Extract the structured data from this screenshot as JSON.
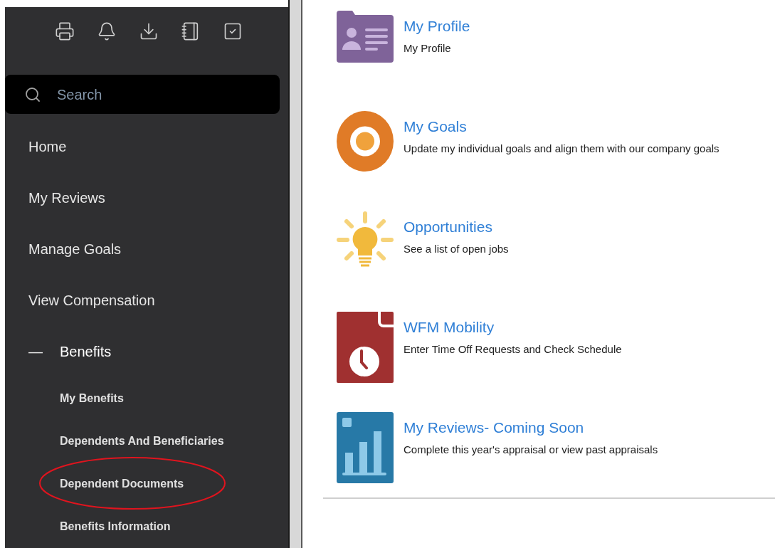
{
  "sidebar": {
    "toolbar": [
      {
        "kind": "print"
      },
      {
        "kind": "bell"
      },
      {
        "kind": "download"
      },
      {
        "kind": "notebook"
      },
      {
        "kind": "checklist"
      }
    ],
    "search": {
      "placeholder": "Search"
    },
    "items": [
      {
        "label": "Home",
        "expanded": false
      },
      {
        "label": "My Reviews",
        "expanded": false
      },
      {
        "label": "Manage Goals",
        "expanded": false
      },
      {
        "label": "View Compensation",
        "expanded": false
      },
      {
        "label": "Benefits",
        "expanded": true,
        "toggle": "—",
        "children": [
          {
            "label": "My Benefits",
            "circled": false
          },
          {
            "label": "Dependents And Beneficiaries",
            "circled": false
          },
          {
            "label": "Dependent Documents",
            "circled": true
          },
          {
            "label": "Benefits Information",
            "circled": false
          }
        ]
      }
    ]
  },
  "apps": [
    {
      "kind": "profile",
      "title": "My Profile",
      "description": "My Profile"
    },
    {
      "kind": "goals",
      "title": "My Goals",
      "description": "Update my individual goals and align them with our company goals"
    },
    {
      "kind": "idea",
      "title": "Opportunities",
      "description": "See a list of open jobs"
    },
    {
      "kind": "clock",
      "title": "WFM Mobility",
      "description": "Enter Time Off Requests and Check Schedule"
    },
    {
      "kind": "chart",
      "title": "My Reviews- Coming Soon",
      "description": "Complete this year's appraisal or view past appraisals"
    }
  ]
}
